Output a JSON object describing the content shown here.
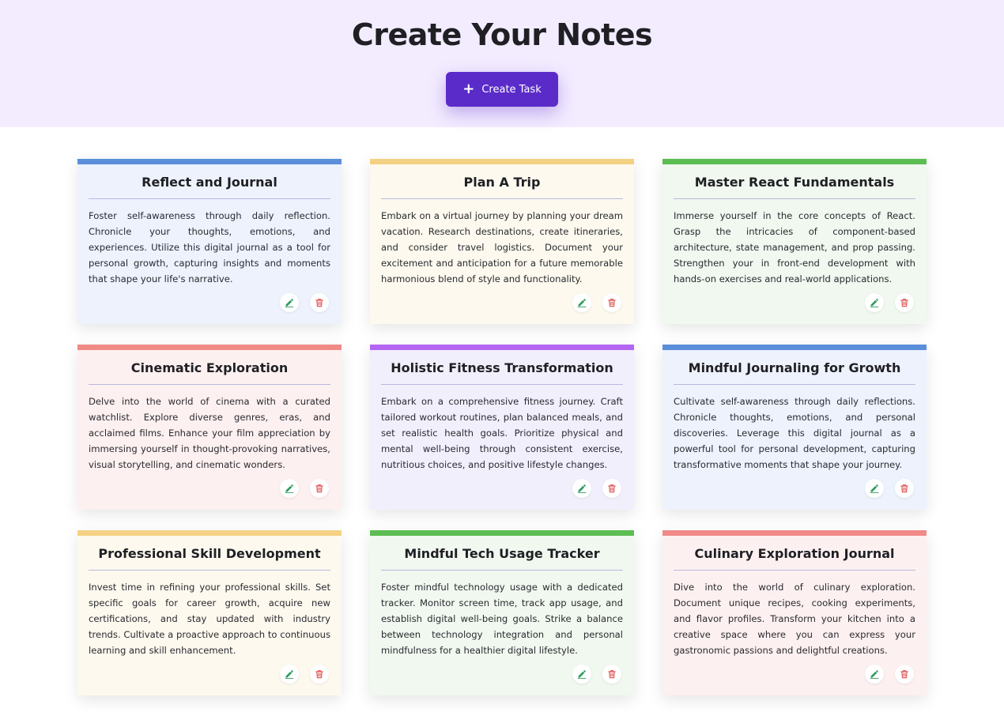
{
  "header": {
    "title": "Create Your Notes",
    "create_button_label": "Create Task",
    "create_button_icon": "plus-icon"
  },
  "colors": {
    "header_bg": "#f3ecff",
    "button_bg": "#5b2bc9",
    "edit_icon": "#2e9b5e",
    "delete_icon": "#e05a5a"
  },
  "cards": [
    {
      "title": "Reflect and Journal",
      "body": "Foster self-awareness through daily reflection. Chronicle your thoughts, emotions, and experiences. Utilize this digital journal as a tool for personal growth, capturing insights and moments that shape your life's narrative.",
      "accent": "#5b8fd9",
      "bg": "#edf2fd"
    },
    {
      "title": "Plan A Trip",
      "body": "Embark on a virtual journey by planning your dream vacation. Research destinations, create itineraries, and consider travel logistics. Document your excitement and anticipation for a future memorable harmonious blend of style and functionality.",
      "accent": "#f4d184",
      "bg": "#fdf9ee"
    },
    {
      "title": "Master React Fundamentals",
      "body": "Immerse yourself in the core concepts of React. Grasp the intricacies of component-based architecture, state management, and prop passing. Strengthen your in front-end development with hands-on exercises and real-world applications.",
      "accent": "#5cbd52",
      "bg": "#f0f8ef"
    },
    {
      "title": "Cinematic Exploration",
      "body": "Delve into the world of cinema with a curated watchlist. Explore diverse genres, eras, and acclaimed films. Enhance your film appreciation by immersing yourself in thought-provoking narratives, visual storytelling, and cinematic wonders.",
      "accent": "#f08a87",
      "bg": "#fdf0f0"
    },
    {
      "title": "Holistic Fitness Transformation",
      "body": "Embark on a comprehensive fitness journey. Craft tailored workout routines, plan balanced meals, and set realistic health goals. Prioritize physical and mental well-being through consistent exercise, nutritious choices, and positive lifestyle changes.",
      "accent": "#b466f2",
      "bg": "#f2effd"
    },
    {
      "title": "Mindful Journaling for Growth",
      "body": "Cultivate self-awareness through daily reflections. Chronicle thoughts, emotions, and personal discoveries. Leverage this digital journal as a powerful tool for personal development, capturing transformative moments that shape your journey.",
      "accent": "#5b8fd9",
      "bg": "#edf2fd"
    },
    {
      "title": "Professional Skill Development",
      "body": "Invest time in refining your professional skills. Set specific goals for career growth, acquire new certifications, and stay updated with industry trends. Cultivate a proactive approach to continuous learning and skill enhancement.",
      "accent": "#f4d184",
      "bg": "#fdf9ee"
    },
    {
      "title": "Mindful Tech Usage Tracker",
      "body": "Foster mindful technology usage with a dedicated tracker. Monitor screen time, track app usage, and establish digital well-being goals. Strike a balance between technology integration and personal mindfulness for a healthier digital lifestyle.",
      "accent": "#5cbd52",
      "bg": "#f0f8ef"
    },
    {
      "title": "Culinary Exploration Journal",
      "body": "Dive into the world of culinary exploration. Document unique recipes, cooking experiments, and flavor profiles. Transform your kitchen into a creative space where you can express your gastronomic passions and delightful creations.",
      "accent": "#f08a87",
      "bg": "#fdf0f0"
    }
  ]
}
